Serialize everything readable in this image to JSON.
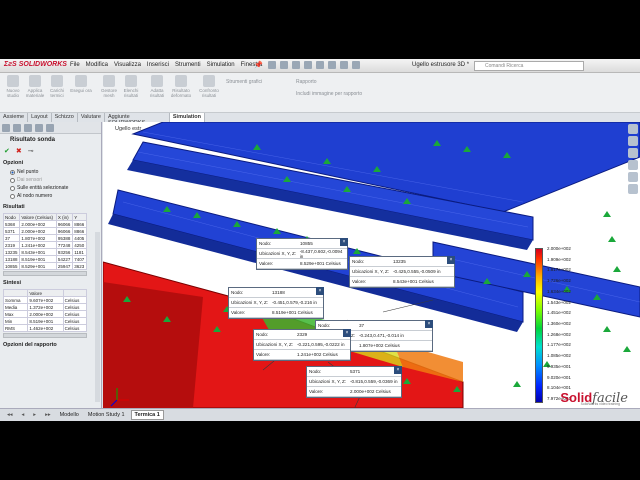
{
  "app": {
    "name": "SOLIDWORKS",
    "doc_title": "Ugello estrusore 3D *",
    "search_placeholder": "Comandi Ricerca"
  },
  "menu": [
    "File",
    "Modifica",
    "Visualizza",
    "Inserisci",
    "Strumenti",
    "Simulation",
    "Finestra"
  ],
  "ribbon": {
    "buttons": [
      "Nuovo studio",
      "Applica materiale",
      "Carichi termici",
      "Esegui ora",
      "Gestore mesh",
      "Elenchi risultati",
      "Adatta risultati",
      "Risultato deformato",
      "Confronto risultati"
    ],
    "lists": [
      "Strumenti grafici",
      "Rapporto",
      "Includi immagine per rapporto"
    ]
  },
  "tabs": [
    "Assieme",
    "Layout",
    "Schizzo",
    "Valutare",
    "Aggiunte SOLIDWORKS",
    "Simulation"
  ],
  "panel": {
    "title": "Risultato sonda",
    "options_header": "Opzioni",
    "options": [
      "Nel punto",
      "Dai sensori",
      "Sulle entità selezionate",
      "Al nodo numero"
    ],
    "results_header": "Risultati",
    "results_cols": [
      "Nodo",
      "Valore (Celsius)",
      "X (in)",
      "Y"
    ],
    "results_rows": [
      [
        "5368",
        "2.000e+002",
        "96066",
        "8866"
      ],
      [
        "5371",
        "2.000e+002",
        "96066",
        "8866"
      ],
      [
        "37",
        "1.807e+002",
        "95388",
        "4405"
      ],
      [
        "2319",
        "1.241e+002",
        "77248",
        "4250"
      ],
      [
        "13235",
        "8.543e+001",
        "93256",
        "1181"
      ],
      [
        "13188",
        "8.519e+001",
        "54227",
        "7407"
      ],
      [
        "10855",
        "8.529e+001",
        "25947",
        "3623"
      ]
    ],
    "summary_header": "Sintesi",
    "summary_col": "Valore",
    "summary_rows": [
      [
        "Somma",
        "9.607e+002",
        "Celsius"
      ],
      [
        "Media",
        "1.372e+002",
        "Celsius"
      ],
      [
        "Max",
        "2.000e+002",
        "Celsius"
      ],
      [
        "Min",
        "8.519e+001",
        "Celsius"
      ],
      [
        "RMS",
        "1.462e+002",
        "Celsius"
      ]
    ],
    "report_header": "Opzioni del rapporto"
  },
  "viewport": {
    "tree_label": "Ugello estr",
    "brand_a": "Solid",
    "brand_b": "facile",
    "brand_sub": "SolidWorks video training"
  },
  "legend": {
    "values": [
      "2.000e+002",
      "1.909e+002",
      "1.817e+002",
      "1.726e+002",
      "1.634e+002",
      "1.543e+002",
      "1.451e+002",
      "1.360e+002",
      "1.268e+002",
      "1.177e+002",
      "1.085e+002",
      "9.935e+001",
      "9.020e+001",
      "8.104e+001",
      "7.972e+001"
    ]
  },
  "probe_labels": {
    "node": "Nodo:",
    "coords": "Ubicazioni X, Y, Z:",
    "value": "Valore:"
  },
  "probes": [
    {
      "node": "10855",
      "coords": "-8.437,0.602,-0.0094 in",
      "value": "8.529e+001 Celsius"
    },
    {
      "node": "13235",
      "coords": "-0.425,0.555,-0.0509 in",
      "value": "8.543e+001 Celsius"
    },
    {
      "node": "13188",
      "coords": "-0.451,0.579,-0.216 in",
      "value": "8.519e+001 Celsius"
    },
    {
      "node": "37",
      "coords": "-0.243,0.471,-0.014 in",
      "value": "1.807e+002 Celsius"
    },
    {
      "node": "2329",
      "coords": "-0.221,0.595,-0.0222 in",
      "value": "1.241e+002 Celsius"
    },
    {
      "node": "5371",
      "coords": "-0.815,0.559,-0.0369 in",
      "value": "2.000e+002 Celsius"
    }
  ],
  "bottom_tabs": [
    "Modello",
    "Motion Study 1",
    "Termica 1"
  ],
  "colors": {
    "accent": "#c8102e",
    "part_blue": "#1a3fcf",
    "part_red": "#e01212"
  }
}
